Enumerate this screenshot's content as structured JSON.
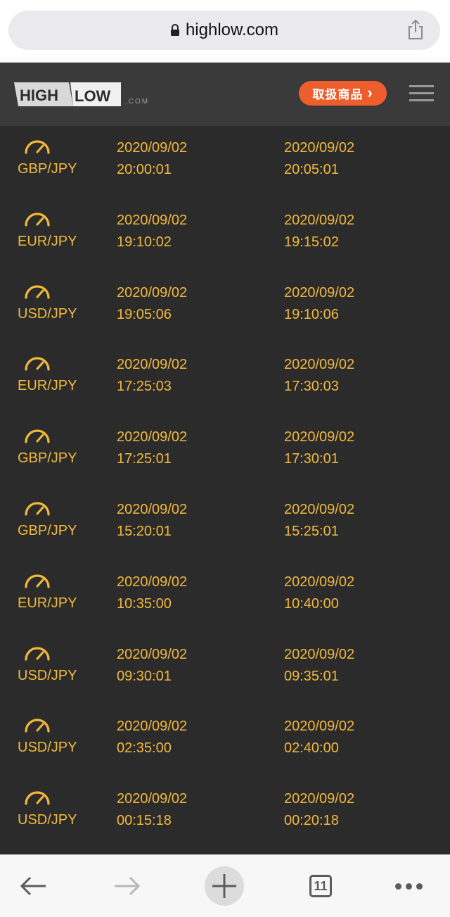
{
  "browser": {
    "url": "highlow.com",
    "tabs_count": "11"
  },
  "header": {
    "logo_high": "HIGH",
    "logo_low": "LOW",
    "logo_dotcom": ".COM",
    "cta_label": "取扱商品",
    "cta_chevron": "›"
  },
  "rows": [
    {
      "pair": "GBP/JPY",
      "start_date": "2020/09/02",
      "start_time": "20:00:01",
      "end_date": "2020/09/02",
      "end_time": "20:05:01"
    },
    {
      "pair": "EUR/JPY",
      "start_date": "2020/09/02",
      "start_time": "19:10:02",
      "end_date": "2020/09/02",
      "end_time": "19:15:02"
    },
    {
      "pair": "USD/JPY",
      "start_date": "2020/09/02",
      "start_time": "19:05:06",
      "end_date": "2020/09/02",
      "end_time": "19:10:06"
    },
    {
      "pair": "EUR/JPY",
      "start_date": "2020/09/02",
      "start_time": "17:25:03",
      "end_date": "2020/09/02",
      "end_time": "17:30:03"
    },
    {
      "pair": "GBP/JPY",
      "start_date": "2020/09/02",
      "start_time": "17:25:01",
      "end_date": "2020/09/02",
      "end_time": "17:30:01"
    },
    {
      "pair": "GBP/JPY",
      "start_date": "2020/09/02",
      "start_time": "15:20:01",
      "end_date": "2020/09/02",
      "end_time": "15:25:01"
    },
    {
      "pair": "EUR/JPY",
      "start_date": "2020/09/02",
      "start_time": "10:35:00",
      "end_date": "2020/09/02",
      "end_time": "10:40:00"
    },
    {
      "pair": "USD/JPY",
      "start_date": "2020/09/02",
      "start_time": "09:30:01",
      "end_date": "2020/09/02",
      "end_time": "09:35:01"
    },
    {
      "pair": "USD/JPY",
      "start_date": "2020/09/02",
      "start_time": "02:35:00",
      "end_date": "2020/09/02",
      "end_time": "02:40:00"
    },
    {
      "pair": "USD/JPY",
      "start_date": "2020/09/02",
      "start_time": "00:15:18",
      "end_date": "2020/09/02",
      "end_time": "00:20:18"
    }
  ],
  "colors": {
    "accent_orange": "#ee5e2d",
    "text_gold": "#f2b93b",
    "background": "#2b2b2b"
  }
}
